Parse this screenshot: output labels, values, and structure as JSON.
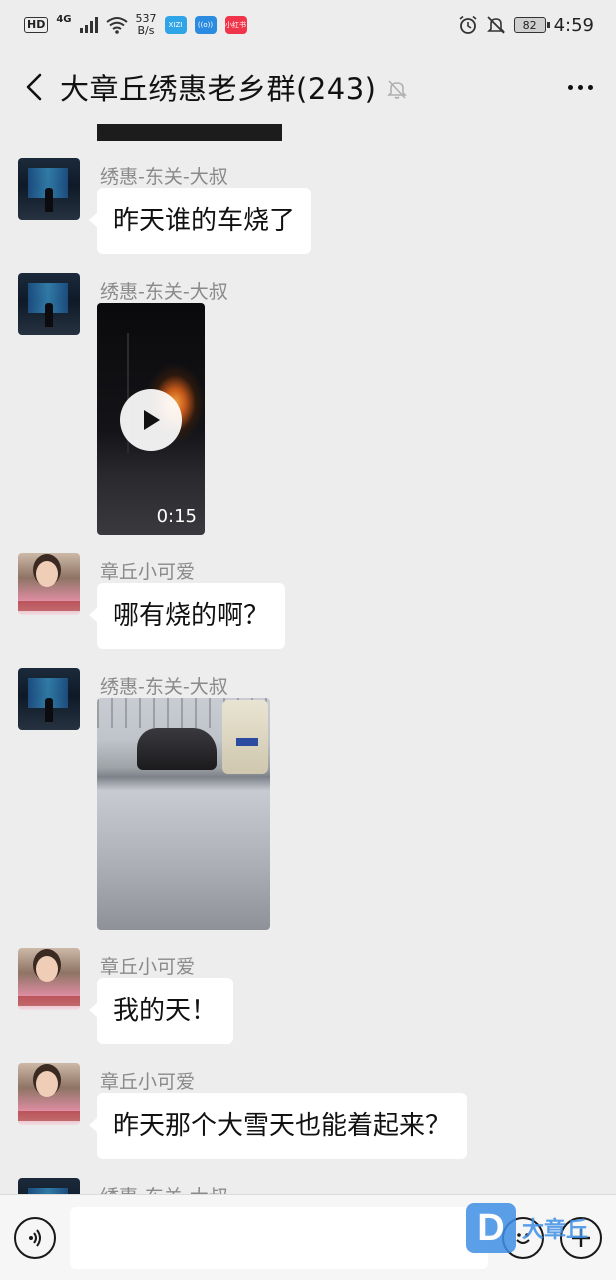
{
  "status_bar": {
    "hd": "HD",
    "network": "4G",
    "speed_value": "537",
    "speed_unit": "B/s",
    "apps": [
      {
        "label": "XIZI",
        "color": "#2fa4e7"
      },
      {
        "label": "((o))",
        "color": "#2b8be0"
      },
      {
        "label": "小红书",
        "color": "#f0344a"
      }
    ],
    "battery": "82",
    "time": "4:59"
  },
  "nav": {
    "title": "大章丘绣惠老乡群(243)"
  },
  "messages": [
    {
      "sender": "绣惠-东关-大叔",
      "type": "text",
      "text": "昨天谁的车烧了"
    },
    {
      "sender": "绣惠-东关-大叔",
      "type": "video",
      "duration": "0:15"
    },
    {
      "sender": "章丘小可爱",
      "type": "text",
      "text": "哪有烧的啊？"
    },
    {
      "sender": "绣惠-东关-大叔",
      "type": "image"
    },
    {
      "sender": "章丘小可爱",
      "type": "text",
      "text": "我的天！"
    },
    {
      "sender": "章丘小可爱",
      "type": "text",
      "text": "昨天那个大雪天也能着起来？"
    },
    {
      "sender": "绣惠-东关-大叔",
      "type": "partial"
    }
  ],
  "input": {
    "placeholder": ""
  },
  "watermark": {
    "logo": "D",
    "text": "大章丘"
  }
}
